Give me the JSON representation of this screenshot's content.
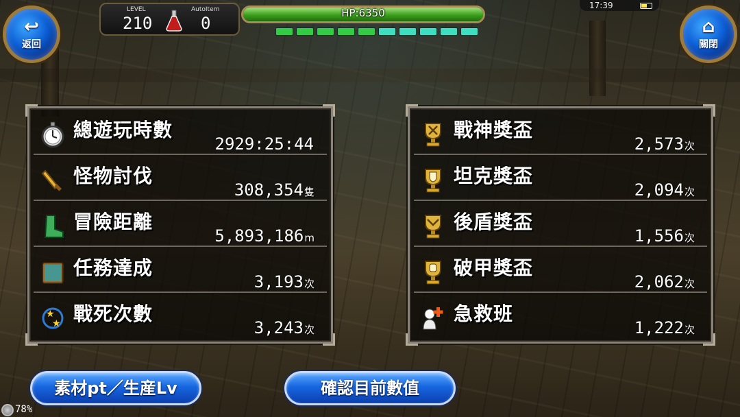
{
  "hud": {
    "back_label": "返回",
    "close_label": "關閉",
    "level_caption": "LEVEL",
    "level_value": "210",
    "autoitem_caption": "AutoItem",
    "autoitem_value": "0",
    "hp_text": "HP:6350",
    "hp_fraction": 1.0,
    "time": "17:39",
    "zoom_text": "78%",
    "segments": [
      {
        "color": "#33cc44"
      },
      {
        "color": "#33cc44"
      },
      {
        "color": "#33cc44"
      },
      {
        "color": "#33cc44"
      },
      {
        "color": "#33cc44"
      },
      {
        "color": "#3ddfc0"
      },
      {
        "color": "#3ddfc0"
      },
      {
        "color": "#3ddfc0"
      },
      {
        "color": "#3ddfc0"
      },
      {
        "color": "#3ddfc0"
      }
    ]
  },
  "left_stats": [
    {
      "label": "總遊玩時數",
      "value": "2929:25:44",
      "unit": "",
      "icon": "stopwatch-icon"
    },
    {
      "label": "怪物討伐",
      "value": "308,354",
      "unit": "隻",
      "icon": "sword-icon"
    },
    {
      "label": "冒險距離",
      "value": "5,893,186",
      "unit": "m",
      "icon": "boot-icon"
    },
    {
      "label": "任務達成",
      "value": "3,193",
      "unit": "次",
      "icon": "book-icon"
    },
    {
      "label": "戰死次數",
      "value": "3,243",
      "unit": "次",
      "icon": "stars-icon"
    }
  ],
  "right_stats": [
    {
      "label": "戰神獎盃",
      "value": "2,573",
      "unit": "次",
      "icon": "trophy-swords-icon"
    },
    {
      "label": "坦克獎盃",
      "value": "2,094",
      "unit": "次",
      "icon": "trophy-shield-icon"
    },
    {
      "label": "後盾獎盃",
      "value": "1,556",
      "unit": "次",
      "icon": "trophy-wings-icon"
    },
    {
      "label": "破甲獎盃",
      "value": "2,062",
      "unit": "次",
      "icon": "trophy-fist-icon"
    },
    {
      "label": "急救班",
      "value": "1,222",
      "unit": "次",
      "icon": "medic-icon"
    }
  ],
  "buttons": {
    "materials": "素材pt／生産Lv",
    "confirm": "確認目前數值"
  },
  "colors": {
    "accent_blue": "#1766e0",
    "hp_green": "#3aa01c",
    "panel_border": "#8a8378"
  }
}
